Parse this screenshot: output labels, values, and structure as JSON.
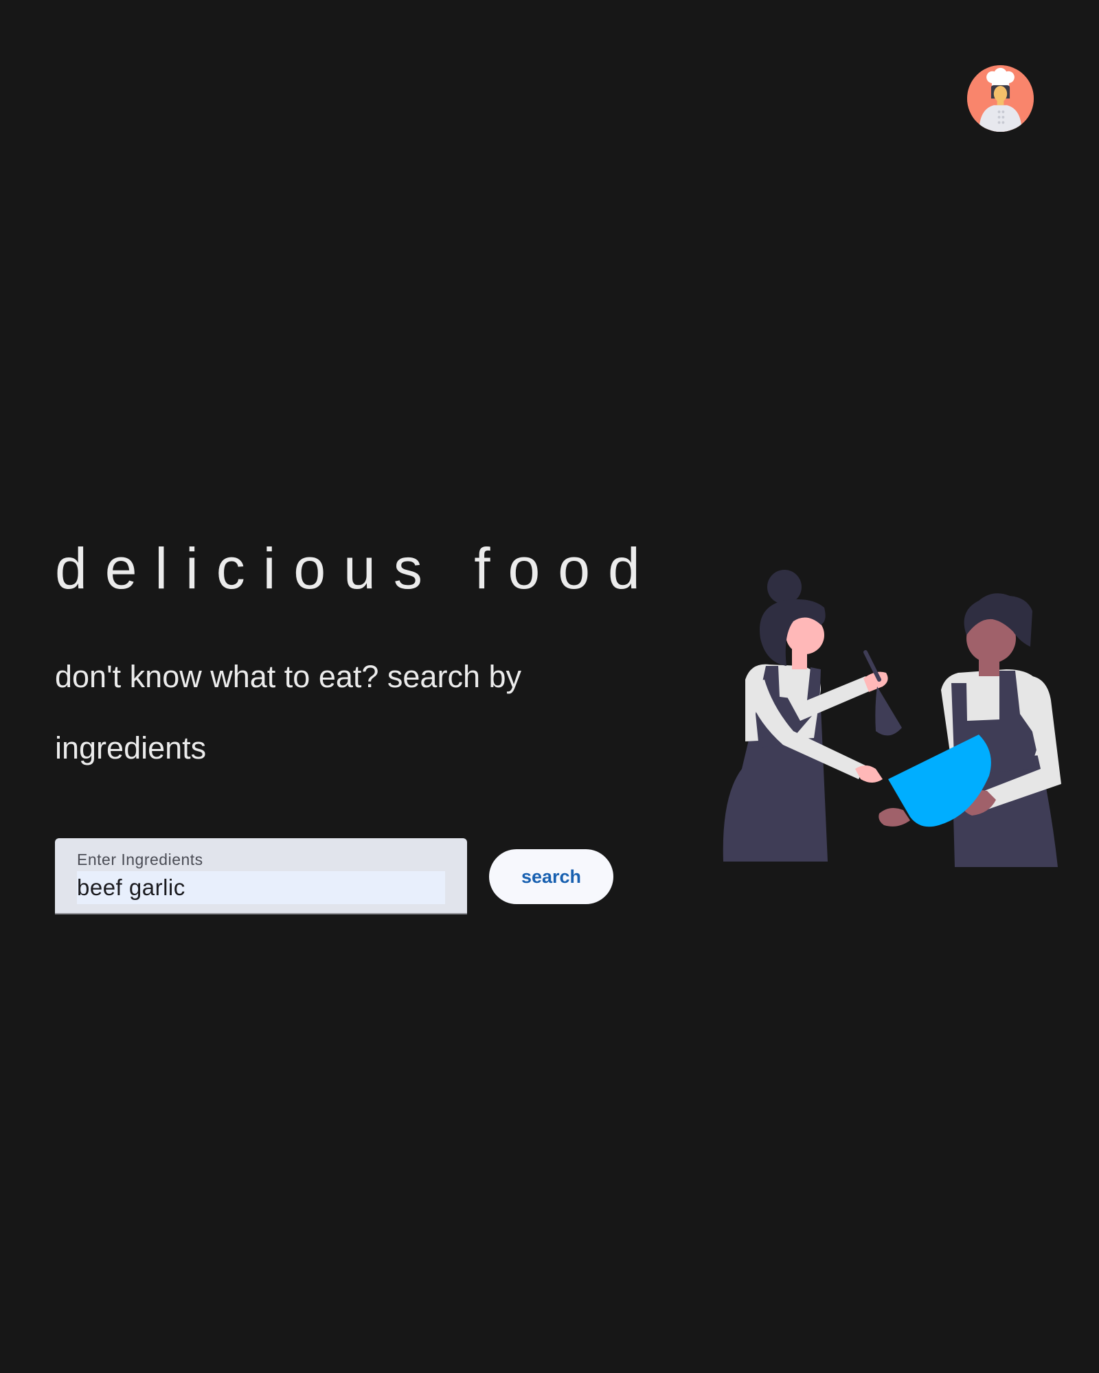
{
  "header": {
    "avatar_icon": "chef-avatar-icon"
  },
  "hero": {
    "title": "delicious food",
    "subtitle": "don't know what to eat? search by ingredients"
  },
  "search": {
    "label": "Enter Ingredients",
    "value": "beef garlic",
    "button_label": "search"
  },
  "illustration": {
    "icon": "chefs-cooking-illustration"
  },
  "colors": {
    "background": "#171717",
    "avatar_bg": "#f9856c",
    "button_text": "#1860b0",
    "bowl": "#00aeff"
  }
}
